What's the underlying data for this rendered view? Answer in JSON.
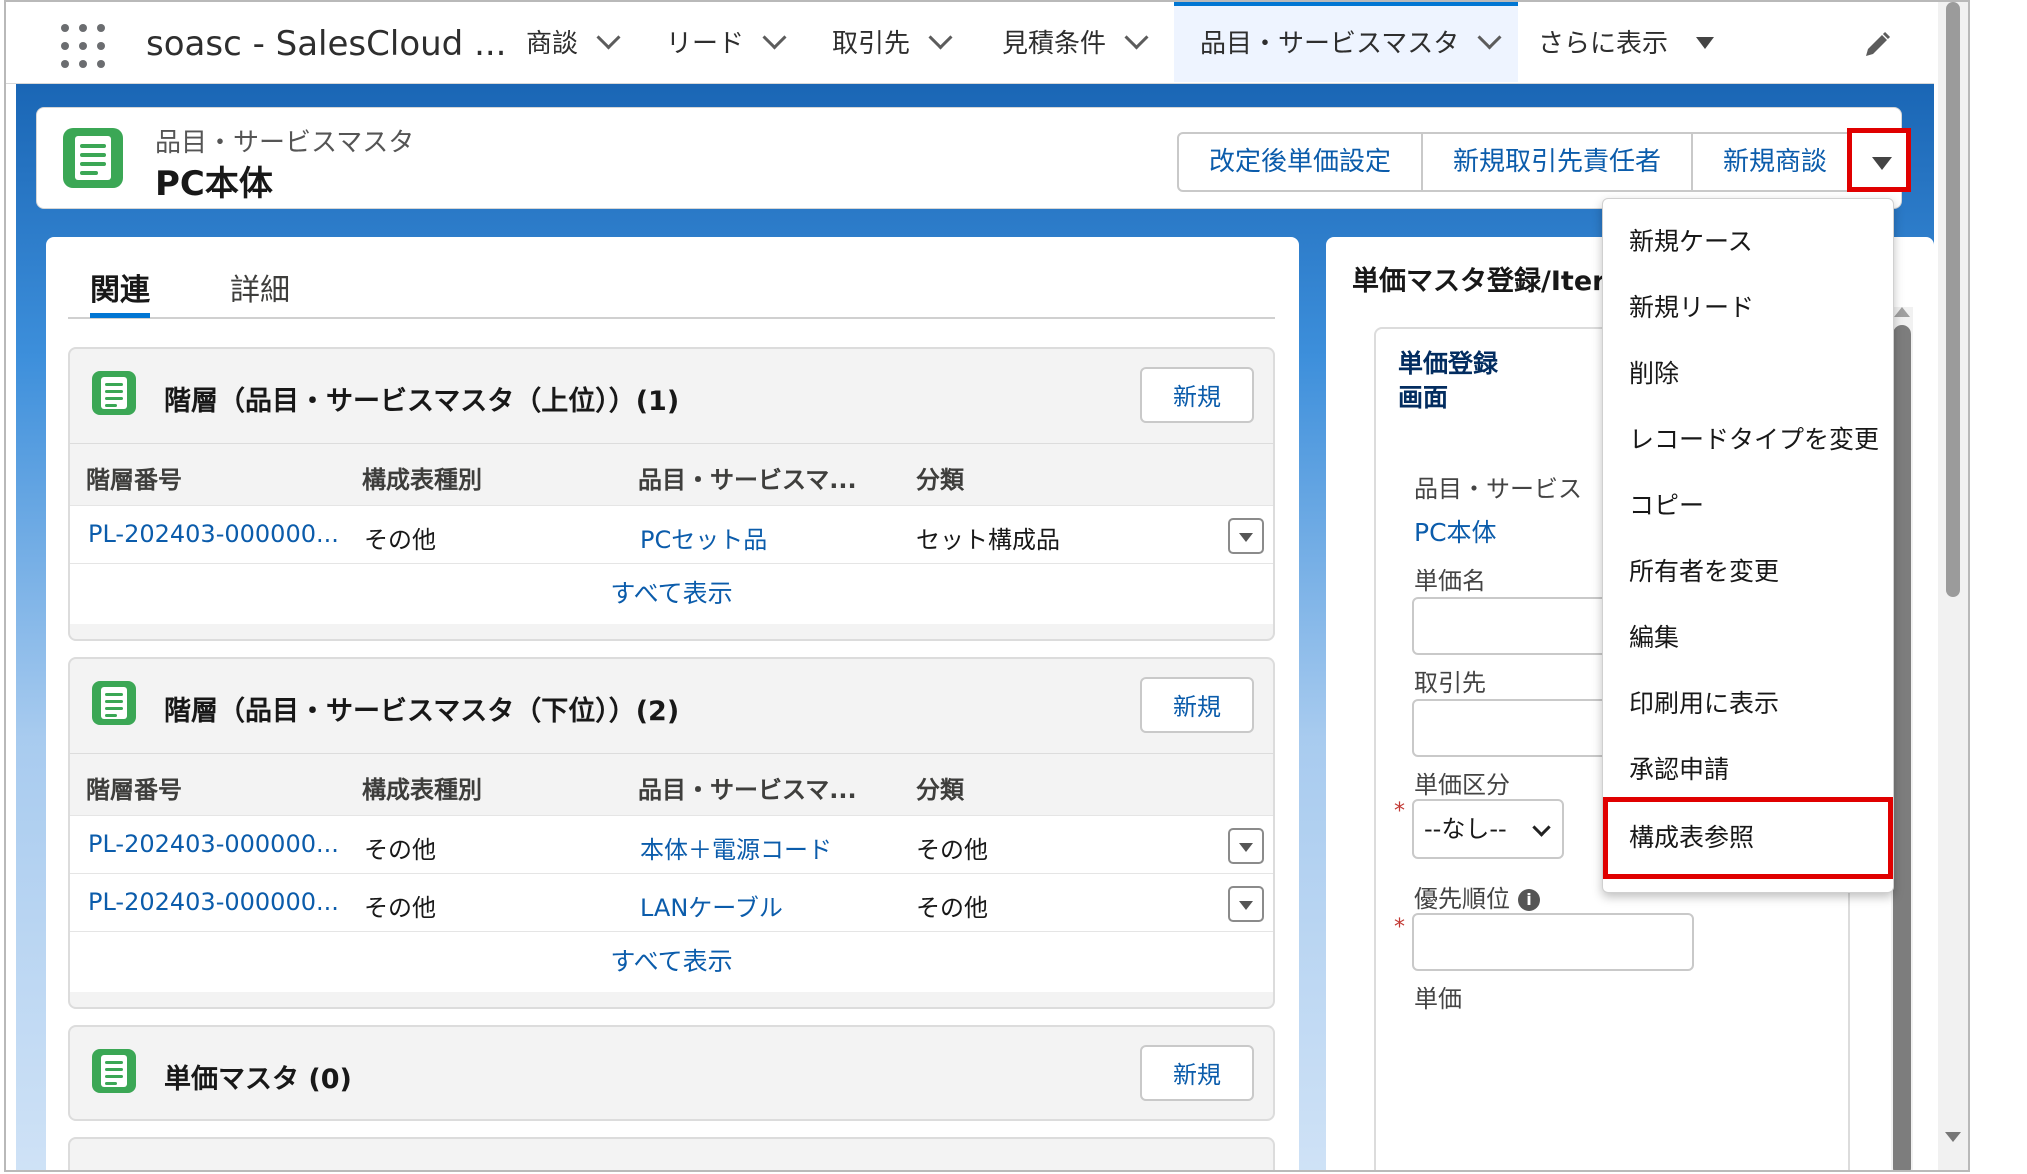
{
  "nav": {
    "app_name": "soasc - SalesCloud ...",
    "tabs": [
      {
        "label": "商談"
      },
      {
        "label": "リード"
      },
      {
        "label": "取引先"
      },
      {
        "label": "見積条件"
      },
      {
        "label": "品目・サービスマスタ"
      }
    ],
    "more_label": "さらに表示"
  },
  "header": {
    "object_label": "品目・サービスマスタ",
    "record_title": "PC本体",
    "actions": [
      "改定後単価設定",
      "新規取引先責任者",
      "新規商談"
    ]
  },
  "tabs": {
    "related": "関連",
    "details": "詳細"
  },
  "cards": [
    {
      "title": "階層（品目・サービスマスタ（上位））(1)",
      "new_label": "新規",
      "columns": [
        "階層番号",
        "構成表種別",
        "品目・サービスマ...",
        "分類"
      ],
      "rows": [
        [
          "PL-202403-000000...",
          "その他",
          "PCセット品",
          "セット構成品"
        ]
      ],
      "view_all": "すべて表示"
    },
    {
      "title": "階層（品目・サービスマスタ（下位））(2)",
      "new_label": "新規",
      "columns": [
        "階層番号",
        "構成表種別",
        "品目・サービスマ...",
        "分類"
      ],
      "rows": [
        [
          "PL-202403-000000...",
          "その他",
          "本体＋電源コード",
          "その他"
        ],
        [
          "PL-202403-000000...",
          "その他",
          "LANケーブル",
          "その他"
        ]
      ],
      "view_all": "すべて表示"
    },
    {
      "title": "単価マスタ (0)",
      "new_label": "新規"
    }
  ],
  "right_panel": {
    "title": "単価マスタ登録/Iter",
    "inner_title_1": "単価登録",
    "inner_title_2": "画面",
    "field_item_label": "品目・サービス",
    "field_item_value": "PC本体",
    "field_price_name_label": "単価名",
    "field_account_label": "取引先",
    "field_price_class_label": "単価区分",
    "field_price_class_value": "--なし--",
    "field_priority_label": "優先順位",
    "field_price_label": "単価",
    "required_mark": "*"
  },
  "dropdown": {
    "items": [
      "新規ケース",
      "新規リード",
      "削除",
      "レコードタイプを変更",
      "コピー",
      "所有者を変更",
      "編集",
      "印刷用に表示",
      "承認申請",
      "構成表参照"
    ],
    "highlighted": "構成表参照"
  },
  "colors": {
    "brand": "#0176d3",
    "link": "#0b5cab",
    "highlight": "#e00000",
    "object_icon": "#3ba755"
  }
}
